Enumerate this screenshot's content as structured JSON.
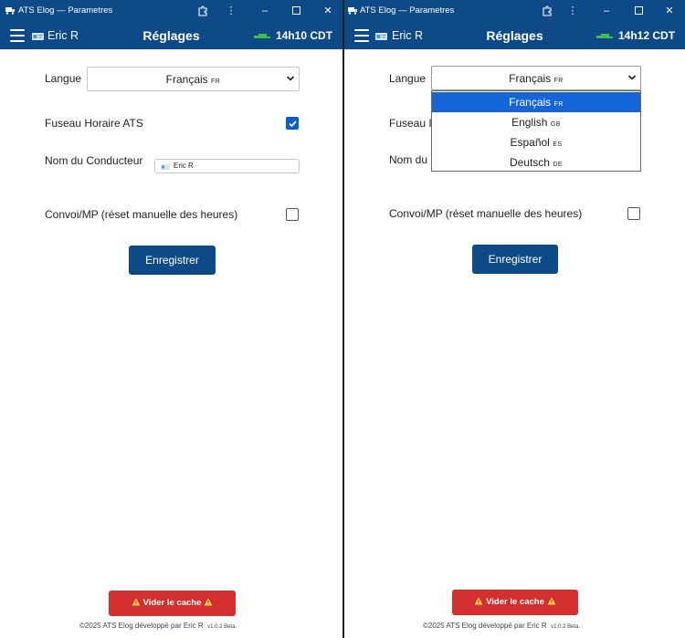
{
  "colors": {
    "titlebar": "#0d4a87",
    "accent_checkbox": "#0a5fd0",
    "danger": "#d32f2f",
    "dropdown_highlight": "#1565d8"
  },
  "left": {
    "window_title": "ATS Elog — Parametres",
    "user_name": "Eric R",
    "page_title": "Réglages",
    "clock": "14h10 CDT",
    "language_label": "Langue",
    "language_value": "Français",
    "language_code": "FR",
    "timezone_label": "Fuseau Horaire ATS",
    "timezone_checked": true,
    "driver_label": "Nom du Conducteur",
    "driver_value": "Eric R",
    "convoy_label": "Convoi/MP (réset manuelle des heures)",
    "convoy_checked": false,
    "save_label": "Enregistrer",
    "cache_label": "Vider le cache",
    "footer_text": "©2025 ATS Elog développé par Eric R",
    "version": "v1.0.2 Beta."
  },
  "right": {
    "window_title": "ATS Elog — Parametres",
    "user_name": "Eric R",
    "page_title": "Réglages",
    "clock": "14h12 CDT",
    "language_label": "Langue",
    "language_value": "Français",
    "language_code": "FR",
    "timezone_label_partial": "Fuseau I",
    "driver_label_partial": "Nom du",
    "convoy_label": "Convoi/MP (réset manuelle des heures)",
    "convoy_checked": false,
    "save_label": "Enregistrer",
    "cache_label": "Vider le cache",
    "footer_text": "©2025 ATS Elog développé par Eric R",
    "version": "v1.0.2 Beta.",
    "dropdown_options": [
      {
        "label": "Français",
        "code": "FR",
        "selected": true
      },
      {
        "label": "English",
        "code": "GB",
        "selected": false
      },
      {
        "label": "Español",
        "code": "ES",
        "selected": false
      },
      {
        "label": "Deutsch",
        "code": "DE",
        "selected": false
      }
    ]
  },
  "icons": {
    "app": "truck-icon",
    "menu": "hamburger-menu-icon",
    "user": "id-card-icon",
    "status": "truck-icon",
    "extension": "puzzle-icon",
    "more": "kebab-menu-icon",
    "minimize": "minimize-icon",
    "maximize": "maximize-icon",
    "close": "close-icon",
    "warning": "warning-icon"
  }
}
